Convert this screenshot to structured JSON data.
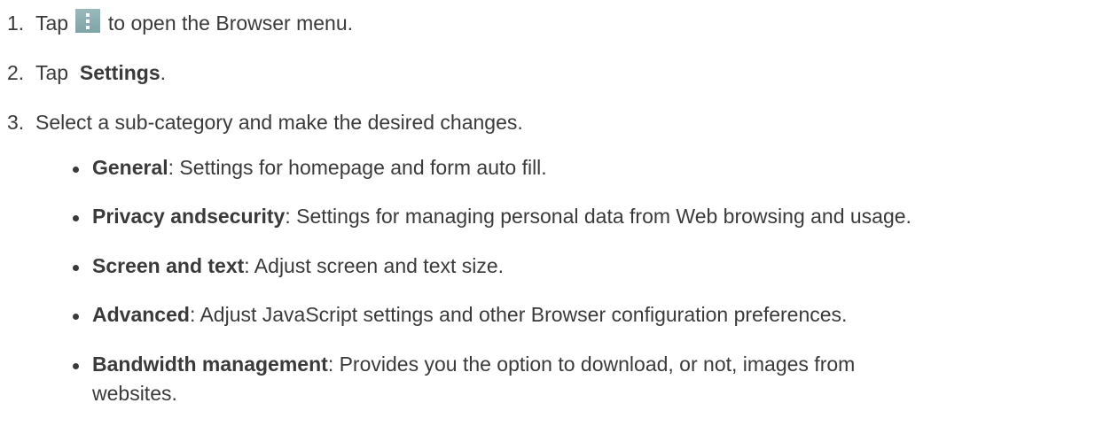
{
  "steps": [
    {
      "number": "1.",
      "before_icon": "Tap",
      "icon": "menu-dots-icon",
      "after_icon": " to open the Browser menu."
    },
    {
      "number": "2.",
      "prefix": "Tap ",
      "bold": "Settings",
      "suffix": "."
    },
    {
      "number": "3.",
      "text": "Select a sub-category and make the desired changes."
    }
  ],
  "bullets": [
    {
      "term": "General",
      "desc": ": Settings for homepage and form auto fill."
    },
    {
      "term": "Privacy andsecurity",
      "desc": ": Settings for managing personal data from Web browsing and usage."
    },
    {
      "term": "Screen and text",
      "desc": ": Adjust screen and text size."
    },
    {
      "term": "Advanced",
      "desc": ": Adjust JavaScript settings and other Browser configuration preferences."
    },
    {
      "term": "Bandwidth management",
      "desc": ": Provides you the option to download, or not, images from websites."
    }
  ],
  "colors": {
    "text": "#3a3a3a",
    "icon_bg": "#8aafb3"
  }
}
